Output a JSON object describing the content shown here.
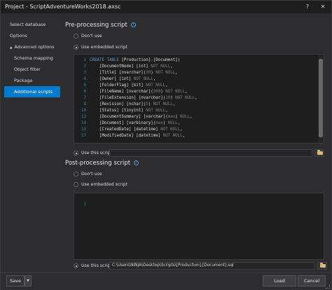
{
  "window": {
    "title": "Project - ScriptAdventureWorks2018.axsc",
    "help_label": "?",
    "close_label": "✕"
  },
  "sidebar": {
    "items": [
      {
        "label": "Select database"
      },
      {
        "label": "Options"
      },
      {
        "label": "Advanced options",
        "expander": "▲"
      },
      {
        "label": "Schema mapping"
      },
      {
        "label": "Object filter"
      },
      {
        "label": "Package"
      },
      {
        "label": "Additional scripts",
        "active": true
      }
    ]
  },
  "pre": {
    "title": "Pre-processing script",
    "dont_use_label": "Don't use",
    "embedded_label": "Use embedded script",
    "use_this_label": "Use this script:",
    "path_value": "",
    "code_lines": [
      {
        "n": "1",
        "t": "CREATE TABLE [Production].[Document]("
      },
      {
        "n": "2",
        "t": "    [DocumentNode] [int] NOT NULL,"
      },
      {
        "n": "3",
        "t": "    [Title] [nvarchar](30) NOT NULL,"
      },
      {
        "n": "4",
        "t": "    [Owner] [int] NOT NULL,"
      },
      {
        "n": "5",
        "t": "    [FolderFlag] [bit] NOT NULL,"
      },
      {
        "n": "6",
        "t": "    [FileName] [nvarchar](300) NOT NULL,"
      },
      {
        "n": "7",
        "t": "    [FileExtension] [nvarchar](10) NOT NULL,"
      },
      {
        "n": "8",
        "t": "    [Revision] [nchar](5) NOT NULL,"
      },
      {
        "n": "10",
        "t": "    [Status] [tinyint] NOT NULL,"
      },
      {
        "n": "13",
        "t": "    [DocumentSummary] [varchar](max) NULL,"
      },
      {
        "n": "14",
        "t": "    [Document] [varbinary](max) NULL,"
      },
      {
        "n": "15",
        "t": "    [CreatedDate] [datetime] NOT NULL,"
      },
      {
        "n": "17",
        "t": "    [ModifiedDate] [datetime] NOT NULL,"
      }
    ]
  },
  "post": {
    "title": "Post-processing script",
    "dont_use_label": "Don't use",
    "embedded_label": "Use embedded script",
    "use_this_label": "Use this script:",
    "line_number": "1",
    "path_value": "C:\\Users\\NINJA\\Desktop\\Scripts\\[Production].[Document].sql"
  },
  "footer": {
    "save_label": "Save",
    "load_label": "Load",
    "cancel_label": "Cancel"
  },
  "colors": {
    "accent": "#007acc",
    "keyword": "#569cd6",
    "line_number": "#2b91af"
  }
}
